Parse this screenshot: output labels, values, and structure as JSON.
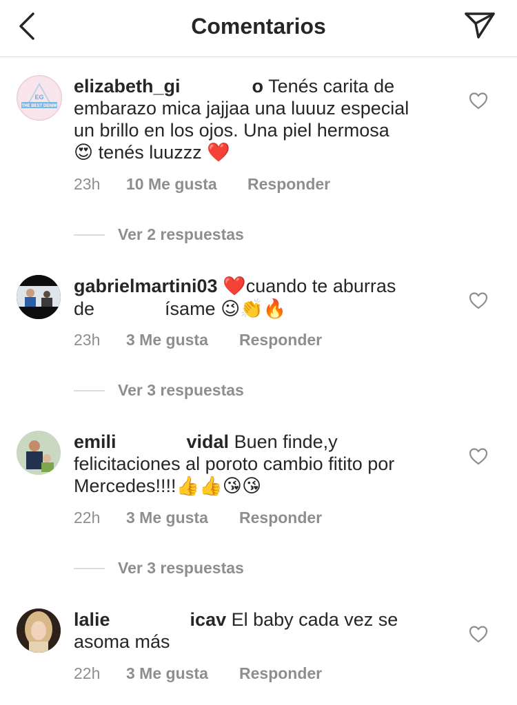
{
  "header": {
    "title": "Comentarios",
    "back_icon": "chevron-left-icon",
    "send_icon": "paper-plane-icon"
  },
  "comments": [
    {
      "username": "elizabeth_gi",
      "username_tail": "o",
      "text_line1": "Tenés carita de",
      "text_line2": "embarazo mica jajjaa una luuuz especial",
      "text_line3": "un brillo en los ojos. Una piel hermosa",
      "text_line4a": "😍",
      "text_line4b": "tenés luuzzz",
      "text_line4c": "❤️",
      "time": "23h",
      "likes": "10 Me gusta",
      "reply": "Responder",
      "view_replies": "Ver 2 respuestas",
      "avatar_text": "EG",
      "avatar_sub": "THE BEST DENIM"
    },
    {
      "username": "gabrielmartini03",
      "text_line1a": "❤️",
      "text_line1b": "cuando te aburras",
      "text_line2a": "de",
      "text_line2b": "ísame",
      "text_line2c": "😉👏🔥",
      "time": "23h",
      "likes": "3 Me gusta",
      "reply": "Responder",
      "view_replies": "Ver 3 respuestas"
    },
    {
      "username": "emili",
      "username_tail": "vidal",
      "text_line1": "Buen finde,y",
      "text_line2": "felicitaciones al poroto cambio fitito por",
      "text_line3a": "Mercedes!!!!",
      "text_line3b": "👍👍😘😘",
      "time": "22h",
      "likes": "3 Me gusta",
      "reply": "Responder",
      "view_replies": "Ver 3 respuestas"
    },
    {
      "username": "lalie",
      "username_tail": "icav",
      "text_line1": "El baby cada vez se",
      "text_line2": "asoma más",
      "time": "22h",
      "likes": "3 Me gusta",
      "reply": "Responder"
    }
  ],
  "colors": {
    "text": "#262626",
    "muted": "#8e8e8e",
    "divider": "#dbdbdb"
  }
}
